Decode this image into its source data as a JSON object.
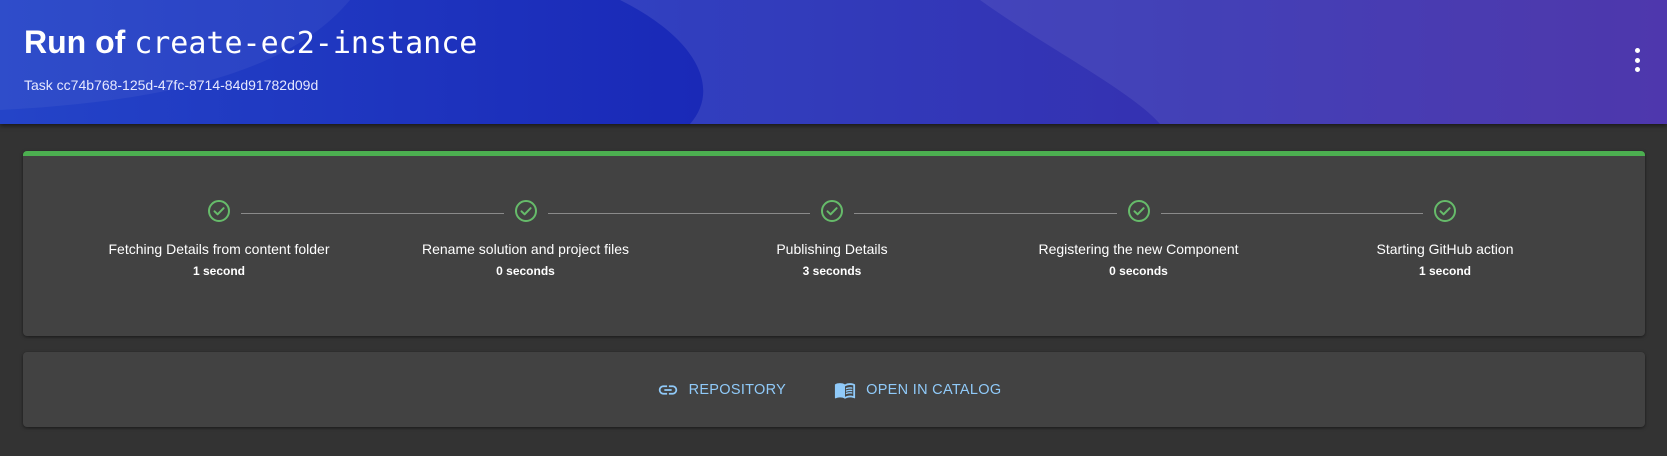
{
  "header": {
    "title_prefix": "Run of",
    "template_name": "create-ec2-instance",
    "subtitle": "Task cc74b768-125d-47fc-8714-84d91782d09d",
    "menu_icon": "more-vert-icon",
    "gradient_colors": [
      "#2444c8",
      "#1a2ab8",
      "#2a0f9c"
    ]
  },
  "progress": {
    "percent": 100,
    "color": "#4caf50"
  },
  "steps": [
    {
      "label": "Fetching Details from content folder",
      "duration": "1 second",
      "status": "completed",
      "icon": "check-circle-icon"
    },
    {
      "label": "Rename solution and project files",
      "duration": "0 seconds",
      "status": "completed",
      "icon": "check-circle-icon"
    },
    {
      "label": "Publishing Details",
      "duration": "3 seconds",
      "status": "completed",
      "icon": "check-circle-icon"
    },
    {
      "label": "Registering the new Component",
      "duration": "0 seconds",
      "status": "completed",
      "icon": "check-circle-icon"
    },
    {
      "label": "Starting GitHub action",
      "duration": "1 second",
      "status": "completed",
      "icon": "check-circle-icon"
    }
  ],
  "step_icon_color": "#66bb6a",
  "links": {
    "repository": {
      "label": "REPOSITORY",
      "icon": "link-icon"
    },
    "catalog": {
      "label": "OPEN IN CATALOG",
      "icon": "book-icon"
    },
    "color": "#90caf9"
  }
}
